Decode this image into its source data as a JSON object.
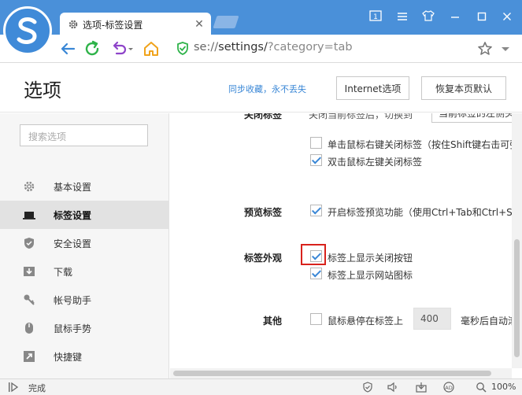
{
  "browser": {
    "tab_title": "选项-标签设置",
    "address": {
      "host": "se://",
      "path": "settings/",
      "query": "?category=tab"
    },
    "colors": {
      "titlebar": "#4a90d9",
      "accent": "#3a87d6",
      "highlight": "#d8221c"
    },
    "window_icons": [
      "reading-mode-icon",
      "menu-icon",
      "skin-icon",
      "minimize-icon",
      "maximize-icon",
      "close-icon"
    ]
  },
  "header": {
    "title": "选项",
    "sync_link": "同步收藏，永不丢失",
    "internet_options": "Internet选项",
    "restore_defaults": "恢复本页默认"
  },
  "sidebar": {
    "search_placeholder": "搜索选项",
    "items": [
      {
        "label": "基本设置",
        "icon": "gear-icon",
        "active": false
      },
      {
        "label": "标签设置",
        "icon": "tab-icon",
        "active": true
      },
      {
        "label": "安全设置",
        "icon": "shield-check-icon",
        "active": false
      },
      {
        "label": "下载",
        "icon": "download-icon",
        "active": false
      },
      {
        "label": "帐号助手",
        "icon": "key-icon",
        "active": false
      },
      {
        "label": "鼠标手势",
        "icon": "mouse-icon",
        "active": false
      },
      {
        "label": "快捷键",
        "icon": "shortcut-icon",
        "active": false
      }
    ]
  },
  "content": {
    "cut_section": {
      "label": "关闭标签",
      "text": "关闭当前标签后，切换到",
      "select": "当前标签的左侧头部"
    },
    "close_options": [
      {
        "label": "单击鼠标右键关闭标签（按住Shift键右击可弹",
        "checked": false
      },
      {
        "label": "双击鼠标左键关闭标签",
        "checked": true
      }
    ],
    "preview": {
      "section": "预览标签",
      "option": {
        "label": "开启标签预览功能（使用Ctrl+Tab和Ctrl+Sh",
        "checked": true
      }
    },
    "appearance": {
      "section": "标签外观",
      "options": [
        {
          "label": "标签上显示关闭按钮",
          "checked": true
        },
        {
          "label": "标签上显示网站图标",
          "checked": true
        }
      ]
    },
    "other": {
      "section": "其他",
      "option": {
        "label": "鼠标悬停在标签上",
        "checked": false
      },
      "delay_value": "400",
      "delay_suffix": "毫秒后自动滚"
    }
  },
  "statusbar": {
    "status": "完成",
    "zoom": "100%"
  }
}
